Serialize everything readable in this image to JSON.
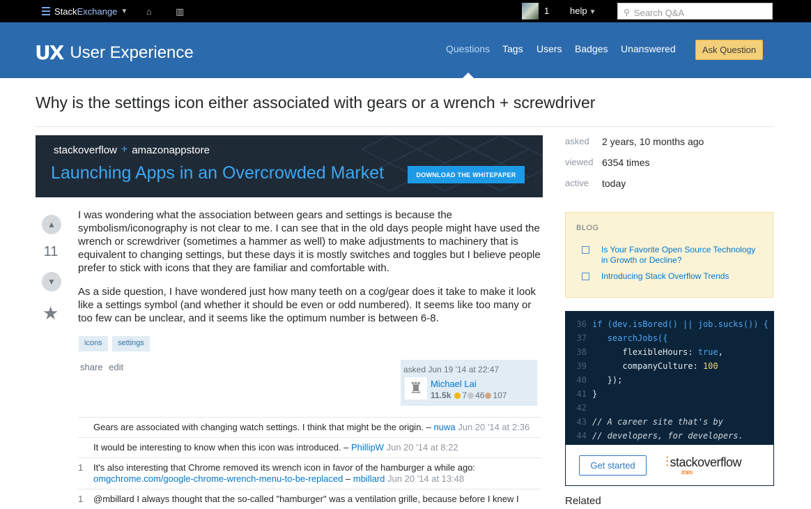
{
  "topbar": {
    "brand_left": "Stack",
    "brand_right": "Exchange",
    "rep": "1",
    "help": "help",
    "search_placeholder": "Search Q&A"
  },
  "header": {
    "logo_mark": "UX",
    "site_name": "User Experience",
    "nav": [
      "Questions",
      "Tags",
      "Users",
      "Badges",
      "Unanswered"
    ],
    "ask_button": "Ask Question"
  },
  "question": {
    "title": "Why is the settings icon either associated with gears or a wrench + screwdriver",
    "votes": "11",
    "paragraphs": [
      "I was wondering what the association between gears and settings is because the symbolism/iconography is not clear to me. I can see that in the old days people might have used the wrench or screwdriver (sometimes a hammer as well) to make adjustments to machinery that is equivalent to changing settings, but these days it is mostly switches and toggles but I believe people prefer to stick with icons that they are familiar and comfortable with.",
      "As a side question, I have wondered just how many teeth on a cog/gear does it take to make it look like a settings symbol (and whether it should be even or odd numbered). It seems like too many or too few can be unclear, and it seems like the optimum number is between 6-8."
    ],
    "tags": [
      "icons",
      "settings"
    ],
    "menu": [
      "share",
      "edit"
    ],
    "owner": {
      "asked": "asked Jun 19 '14 at 22:47",
      "name": "Michael Lai",
      "rep": "11.5k",
      "gold": "7",
      "silver": "46",
      "bronze": "107"
    }
  },
  "banner": {
    "top_left": "stackoverflow",
    "top_plus": "+",
    "top_right": "amazonappstore",
    "headline": "Launching Apps in an Overcrowded Market",
    "button": "DOWNLOAD THE WHITEPAPER"
  },
  "comments": [
    {
      "score": "",
      "text": "Gears are associated with changing watch settings. I think that might be the origin. –",
      "user": "nuwa",
      "date": "Jun 20 '14 at 2:36"
    },
    {
      "score": "",
      "text": "It would be interesting to know when this icon was introduced. –",
      "user": "PhillipW",
      "date": "Jun 20 '14 at 8:22"
    },
    {
      "score": "1",
      "text": "It's also interesting that Chrome removed its wrench icon in favor of the hamburger a while ago:",
      "link": "omgchrome.com/google-chrome-wrench-menu-to-be-replaced",
      "sep": "–",
      "user": "mbillard",
      "date": "Jun 20 '14 at 13:48"
    },
    {
      "score": "1",
      "text": "@mbillard I always thought that the so-called \"hamburger\" was a ventilation grille, because before I knew I"
    }
  ],
  "sidebar": {
    "stats": [
      {
        "label": "asked",
        "value": "2 years, 10 months ago"
      },
      {
        "label": "viewed",
        "value": "6354 times"
      },
      {
        "label": "active",
        "value": "today"
      }
    ],
    "blog_heading": "BLOG",
    "blog_items": [
      "Is Your Favorite Open Source Technology in Growth or Decline?",
      "Introducing Stack Overflow Trends"
    ],
    "jobs_button": "Get started",
    "jobs_brand": "stackoverflow",
    "jobs_sub": "JOBS",
    "related": "Related"
  },
  "code_lines": [
    {
      "n": "36",
      "t": ""
    },
    {
      "n": "37",
      "t": ""
    },
    {
      "n": "38",
      "t": ""
    },
    {
      "n": "39",
      "t": ""
    },
    {
      "n": "40",
      "t": ""
    },
    {
      "n": "41",
      "t": ""
    },
    {
      "n": "42",
      "t": ""
    },
    {
      "n": "43",
      "t": ""
    },
    {
      "n": "44",
      "t": ""
    }
  ],
  "code_text": {
    "l36": "if (dev.isBored() || job.sucks()) {",
    "l37": "searchJobs({",
    "l38a": "flexibleHours: ",
    "l38b": "true",
    "l38c": ",",
    "l39a": "companyCulture: ",
    "l39b": "100",
    "l40": "});",
    "l41": "}",
    "l43": "// A career site that's by",
    "l44": "// developers, for developers."
  },
  "colors": {
    "header_bg": "#2b6aac",
    "topbar_bg": "#000000",
    "link": "#0077cc",
    "ask_button": "#f4cf7a",
    "jobs_bg": "#0c2439"
  }
}
